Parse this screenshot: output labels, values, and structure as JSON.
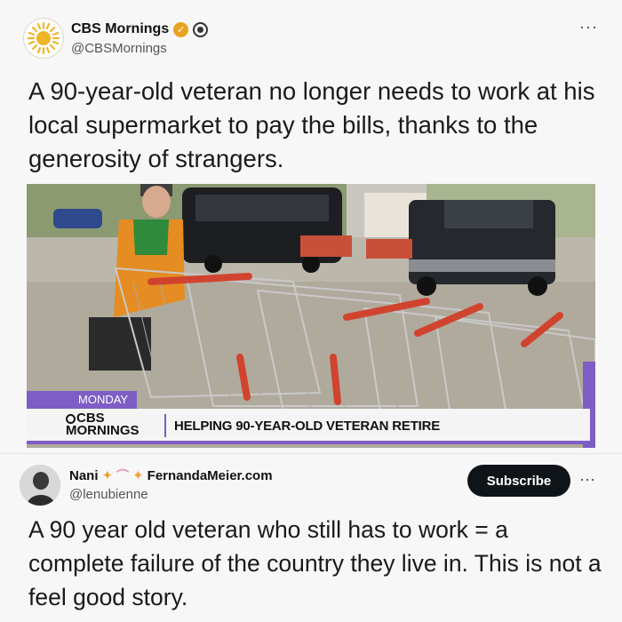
{
  "tweet": {
    "author_name": "CBS Mornings",
    "author_handle": "@CBSMornings",
    "more_label": "···",
    "text": "A 90-year-old veteran no longer needs to work at his local supermarket to pay the bills, thanks to the generosity of strangers.",
    "media": {
      "day_label": "MONDAY",
      "show_logo_top": "CBS",
      "show_logo_bottom": "MORNINGS",
      "headline": "HELPING 90-YEAR-OLD VETERAN RETIRE"
    }
  },
  "quote_tweet": {
    "author_name": "Nani",
    "author_site": "FernandaMeier.com",
    "author_handle": "@lenubienne",
    "subscribe_label": "Subscribe",
    "more_label": "···",
    "text": "A 90 year old veteran who still has to work = a complete failure of the country they live in. This is not a feel good story."
  },
  "colors": {
    "accent_purple": "#7e5dc4",
    "verified_gold": "#e8a323",
    "subscribe_bg": "#0f1419"
  },
  "icons": [
    "cbs-sun-logo-icon",
    "verified-badge-icon",
    "cbs-eye-icon",
    "more-options-icon",
    "sparkle-icon"
  ]
}
